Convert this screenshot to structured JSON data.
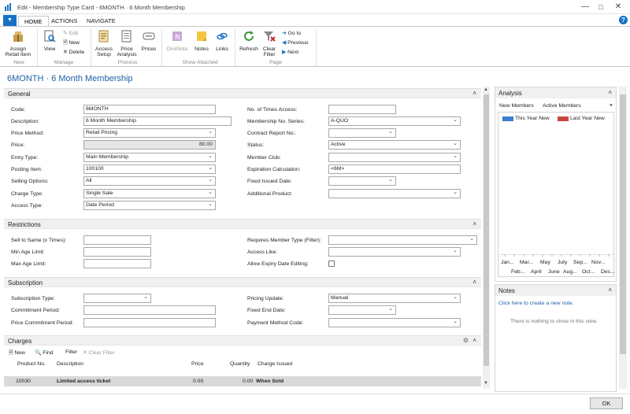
{
  "window": {
    "title": "Edit - Membership Type Card - 6MONTH · 6 Month Membership"
  },
  "tabs": [
    "HOME",
    "ACTIONS",
    "NAVIGATE"
  ],
  "ribbon": {
    "new_group": {
      "label": "New",
      "assign": "Assign Retail Item"
    },
    "manage_group": {
      "label": "Manage",
      "view": "View",
      "edit": "Edit",
      "new": "New",
      "delete": "Delete"
    },
    "process_group": {
      "label": "Process",
      "access_setup": "Access Setup",
      "price_analysis": "Price Analysis",
      "prices": "Prices"
    },
    "attached_group": {
      "label": "Show Attached",
      "onenote": "OneNote",
      "notes": "Notes",
      "links": "Links"
    },
    "page_group": {
      "label": "Page",
      "refresh": "Refresh",
      "clear_filter": "Clear Filter",
      "goto": "Go to",
      "previous": "Previous",
      "next": "Next"
    }
  },
  "page_title": "6MONTH · 6 Month Membership",
  "general": {
    "title": "General",
    "left": [
      {
        "label": "Code:",
        "value": "6MONTH"
      },
      {
        "label": "Description:",
        "value": "6 Month Membership"
      },
      {
        "label": "Price Method:",
        "value": "Retail Pricing"
      },
      {
        "label": "Price:",
        "value": "80.00"
      },
      {
        "label": "Entry Type:",
        "value": "Main Membership"
      },
      {
        "label": "Posting Item:",
        "value": "100100"
      },
      {
        "label": "Selling Options:",
        "value": "All"
      },
      {
        "label": "Charge Type:",
        "value": "Single Sale"
      },
      {
        "label": "Access Type:",
        "value": "Date Period"
      }
    ],
    "right": [
      {
        "label": "No. of Times Access:",
        "value": ""
      },
      {
        "label": "Membership No. Series:",
        "value": "A-QUO"
      },
      {
        "label": "Contract Report No.:",
        "value": ""
      },
      {
        "label": "Status:",
        "value": "Active"
      },
      {
        "label": "Member Club:",
        "value": ""
      },
      {
        "label": "Expiration Calculation:",
        "value": "<6M>"
      },
      {
        "label": "Fixed Issued Date:",
        "value": ""
      },
      {
        "label": "Additional Product:",
        "value": ""
      }
    ]
  },
  "restrictions": {
    "title": "Restrictions",
    "left": [
      {
        "label": "Sell to Same (x Times):",
        "value": ""
      },
      {
        "label": "Min Age Limit:",
        "value": ""
      },
      {
        "label": "Max Age Limit:",
        "value": ""
      }
    ],
    "right": [
      {
        "label": "Requires Member Type (Filter):",
        "value": ""
      },
      {
        "label": "Access Like:",
        "value": ""
      },
      {
        "label": "Allow Expiry Date Editing:",
        "value": ""
      }
    ]
  },
  "subscription": {
    "title": "Subscription",
    "left": [
      {
        "label": "Subscription Type:",
        "value": ""
      },
      {
        "label": "Commitment Period:",
        "value": ""
      },
      {
        "label": "Price Commitment Period:",
        "value": ""
      }
    ],
    "right": [
      {
        "label": "Pricing Update:",
        "value": "Manual"
      },
      {
        "label": "Fixed End Date:",
        "value": ""
      },
      {
        "label": "Payment Method Code:",
        "value": ""
      }
    ]
  },
  "charges": {
    "title": "Charges",
    "toolbar": {
      "new": "New",
      "find": "Find",
      "filter": "Filter",
      "clear_filter": "Clear Filter"
    },
    "columns": [
      "Product No.",
      "Description",
      "Price",
      "Quantity",
      "Charge Issued"
    ],
    "rows": [
      {
        "product_no": "10030",
        "description": "Limited access ticket",
        "price": "0.00",
        "quantity": "0.00",
        "charge_issued": "When Sold"
      }
    ]
  },
  "analysis": {
    "title": "Analysis",
    "tabs": [
      "New Members",
      "Active Members"
    ],
    "more": "»",
    "legend": [
      {
        "name": "This Year New",
        "color": "#3d7fd1"
      },
      {
        "name": "Last Year New",
        "color": "#c9463d"
      }
    ],
    "months_top": [
      "Jan...",
      "Mar...",
      "May",
      "July",
      "Sep...",
      "Nov..."
    ],
    "months_bottom": [
      "Feb...",
      "April",
      "June",
      "Aug...",
      "Oct...",
      "Dec..."
    ]
  },
  "notes_panel": {
    "title": "Notes",
    "link": "Click here to create a new note.",
    "empty": "There is nothing to show in this view."
  },
  "footer": {
    "ok": "OK"
  }
}
